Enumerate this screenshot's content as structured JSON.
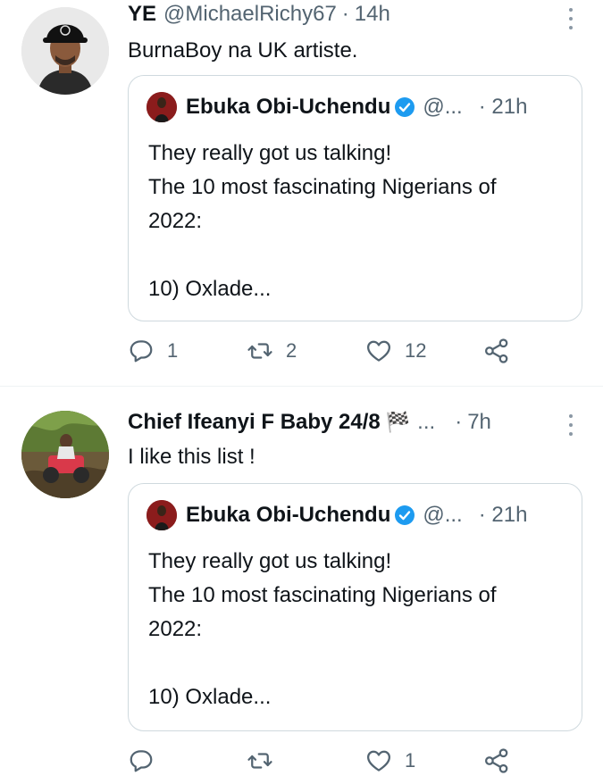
{
  "tweets": [
    {
      "author_name": "YE",
      "author_handle": "@MichaelRichy67",
      "separator": "·",
      "time": "14h",
      "text": "BurnaBoy na UK artiste.",
      "quote": {
        "author_name": "Ebuka Obi-Uchendu",
        "author_handle": "@...",
        "separator": "·",
        "time": "21h",
        "lines": [
          "They really got us talking!",
          "The 10 most fascinating Nigerians of",
          "2022:",
          "",
          "10) Oxlade..."
        ]
      },
      "actions": {
        "reply_count": "1",
        "retweet_count": "2",
        "like_count": "12"
      }
    },
    {
      "author_name": "Chief Ifeanyi F Baby 24/8",
      "flag_glyph": "🏁",
      "ellipsis": "...",
      "separator": "·",
      "time": "7h",
      "text": "I like this list !",
      "quote": {
        "author_name": "Ebuka Obi-Uchendu",
        "author_handle": "@...",
        "separator": "·",
        "time": "21h",
        "lines": [
          "They really got us talking!",
          "The 10 most fascinating Nigerians of",
          "2022:",
          "",
          "10) Oxlade..."
        ]
      },
      "actions": {
        "reply_count": "",
        "retweet_count": "",
        "like_count": "1"
      }
    }
  ],
  "icons": {
    "more": "more-vertical-icon",
    "verified": "verified-badge-icon",
    "reply": "reply-icon",
    "retweet": "retweet-icon",
    "like": "heart-icon",
    "share": "share-icon"
  },
  "colors": {
    "text": "#0f1419",
    "secondary": "#536471",
    "border": "#cfd9de",
    "verified": "#1d9bf0"
  }
}
